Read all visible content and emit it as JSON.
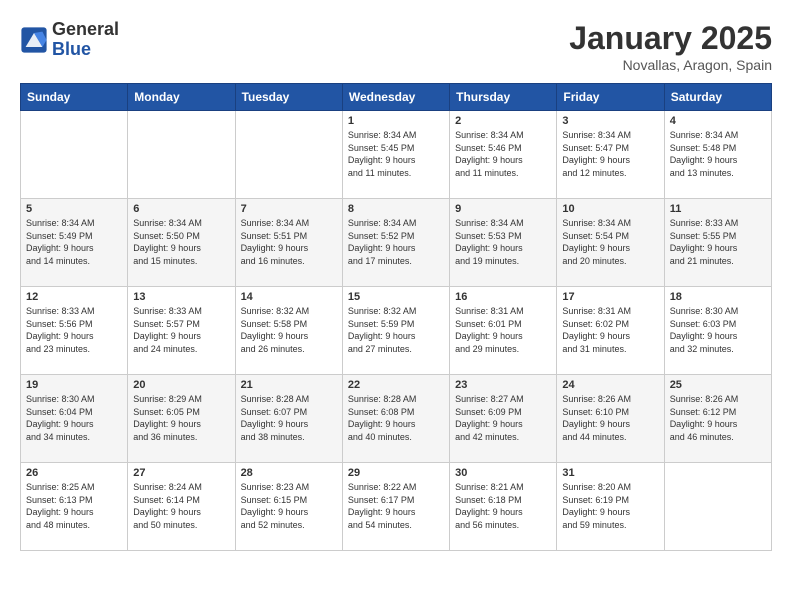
{
  "logo": {
    "general": "General",
    "blue": "Blue"
  },
  "header": {
    "month": "January 2025",
    "location": "Novallas, Aragon, Spain"
  },
  "weekdays": [
    "Sunday",
    "Monday",
    "Tuesday",
    "Wednesday",
    "Thursday",
    "Friday",
    "Saturday"
  ],
  "weeks": [
    [
      {
        "day": "",
        "info": ""
      },
      {
        "day": "",
        "info": ""
      },
      {
        "day": "",
        "info": ""
      },
      {
        "day": "1",
        "info": "Sunrise: 8:34 AM\nSunset: 5:45 PM\nDaylight: 9 hours\nand 11 minutes."
      },
      {
        "day": "2",
        "info": "Sunrise: 8:34 AM\nSunset: 5:46 PM\nDaylight: 9 hours\nand 11 minutes."
      },
      {
        "day": "3",
        "info": "Sunrise: 8:34 AM\nSunset: 5:47 PM\nDaylight: 9 hours\nand 12 minutes."
      },
      {
        "day": "4",
        "info": "Sunrise: 8:34 AM\nSunset: 5:48 PM\nDaylight: 9 hours\nand 13 minutes."
      }
    ],
    [
      {
        "day": "5",
        "info": "Sunrise: 8:34 AM\nSunset: 5:49 PM\nDaylight: 9 hours\nand 14 minutes."
      },
      {
        "day": "6",
        "info": "Sunrise: 8:34 AM\nSunset: 5:50 PM\nDaylight: 9 hours\nand 15 minutes."
      },
      {
        "day": "7",
        "info": "Sunrise: 8:34 AM\nSunset: 5:51 PM\nDaylight: 9 hours\nand 16 minutes."
      },
      {
        "day": "8",
        "info": "Sunrise: 8:34 AM\nSunset: 5:52 PM\nDaylight: 9 hours\nand 17 minutes."
      },
      {
        "day": "9",
        "info": "Sunrise: 8:34 AM\nSunset: 5:53 PM\nDaylight: 9 hours\nand 19 minutes."
      },
      {
        "day": "10",
        "info": "Sunrise: 8:34 AM\nSunset: 5:54 PM\nDaylight: 9 hours\nand 20 minutes."
      },
      {
        "day": "11",
        "info": "Sunrise: 8:33 AM\nSunset: 5:55 PM\nDaylight: 9 hours\nand 21 minutes."
      }
    ],
    [
      {
        "day": "12",
        "info": "Sunrise: 8:33 AM\nSunset: 5:56 PM\nDaylight: 9 hours\nand 23 minutes."
      },
      {
        "day": "13",
        "info": "Sunrise: 8:33 AM\nSunset: 5:57 PM\nDaylight: 9 hours\nand 24 minutes."
      },
      {
        "day": "14",
        "info": "Sunrise: 8:32 AM\nSunset: 5:58 PM\nDaylight: 9 hours\nand 26 minutes."
      },
      {
        "day": "15",
        "info": "Sunrise: 8:32 AM\nSunset: 5:59 PM\nDaylight: 9 hours\nand 27 minutes."
      },
      {
        "day": "16",
        "info": "Sunrise: 8:31 AM\nSunset: 6:01 PM\nDaylight: 9 hours\nand 29 minutes."
      },
      {
        "day": "17",
        "info": "Sunrise: 8:31 AM\nSunset: 6:02 PM\nDaylight: 9 hours\nand 31 minutes."
      },
      {
        "day": "18",
        "info": "Sunrise: 8:30 AM\nSunset: 6:03 PM\nDaylight: 9 hours\nand 32 minutes."
      }
    ],
    [
      {
        "day": "19",
        "info": "Sunrise: 8:30 AM\nSunset: 6:04 PM\nDaylight: 9 hours\nand 34 minutes."
      },
      {
        "day": "20",
        "info": "Sunrise: 8:29 AM\nSunset: 6:05 PM\nDaylight: 9 hours\nand 36 minutes."
      },
      {
        "day": "21",
        "info": "Sunrise: 8:28 AM\nSunset: 6:07 PM\nDaylight: 9 hours\nand 38 minutes."
      },
      {
        "day": "22",
        "info": "Sunrise: 8:28 AM\nSunset: 6:08 PM\nDaylight: 9 hours\nand 40 minutes."
      },
      {
        "day": "23",
        "info": "Sunrise: 8:27 AM\nSunset: 6:09 PM\nDaylight: 9 hours\nand 42 minutes."
      },
      {
        "day": "24",
        "info": "Sunrise: 8:26 AM\nSunset: 6:10 PM\nDaylight: 9 hours\nand 44 minutes."
      },
      {
        "day": "25",
        "info": "Sunrise: 8:26 AM\nSunset: 6:12 PM\nDaylight: 9 hours\nand 46 minutes."
      }
    ],
    [
      {
        "day": "26",
        "info": "Sunrise: 8:25 AM\nSunset: 6:13 PM\nDaylight: 9 hours\nand 48 minutes."
      },
      {
        "day": "27",
        "info": "Sunrise: 8:24 AM\nSunset: 6:14 PM\nDaylight: 9 hours\nand 50 minutes."
      },
      {
        "day": "28",
        "info": "Sunrise: 8:23 AM\nSunset: 6:15 PM\nDaylight: 9 hours\nand 52 minutes."
      },
      {
        "day": "29",
        "info": "Sunrise: 8:22 AM\nSunset: 6:17 PM\nDaylight: 9 hours\nand 54 minutes."
      },
      {
        "day": "30",
        "info": "Sunrise: 8:21 AM\nSunset: 6:18 PM\nDaylight: 9 hours\nand 56 minutes."
      },
      {
        "day": "31",
        "info": "Sunrise: 8:20 AM\nSunset: 6:19 PM\nDaylight: 9 hours\nand 59 minutes."
      },
      {
        "day": "",
        "info": ""
      }
    ]
  ]
}
